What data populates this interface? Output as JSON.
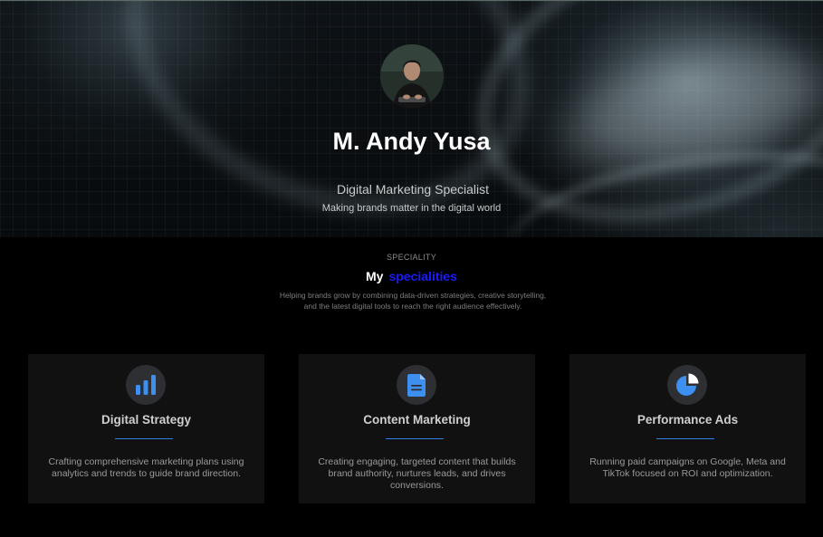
{
  "hero": {
    "name": "M. Andy Yusa",
    "title": "Digital Marketing Specialist",
    "tagline": "Making brands matter in the digital world",
    "avatar_icon": "profile-photo"
  },
  "speciality": {
    "eyebrow": "SPECIALITY",
    "heading_word1": "My",
    "heading_word2": "specialities",
    "description_line1": "Helping brands grow by combining data-driven strategies, creative storytelling,",
    "description_line2": "and the latest digital tools to reach the right audience effectively."
  },
  "cards": [
    {
      "icon": "bar-chart-icon",
      "title": "Digital Strategy",
      "description": "Crafting comprehensive marketing plans using analytics and trends to guide brand direction."
    },
    {
      "icon": "document-icon",
      "title": "Content Marketing",
      "description": "Creating engaging, targeted content that builds brand authority, nurtures leads, and drives conversions."
    },
    {
      "icon": "pie-chart-icon",
      "title": "Performance Ads",
      "description": "Running paid campaigns on Google, Meta and TikTok focused on ROI and optimization."
    }
  ],
  "colors": {
    "accent_blue": "#1a1aff",
    "icon_blue": "#3d8ff0",
    "card_background": "#111111",
    "page_background": "#000000"
  }
}
